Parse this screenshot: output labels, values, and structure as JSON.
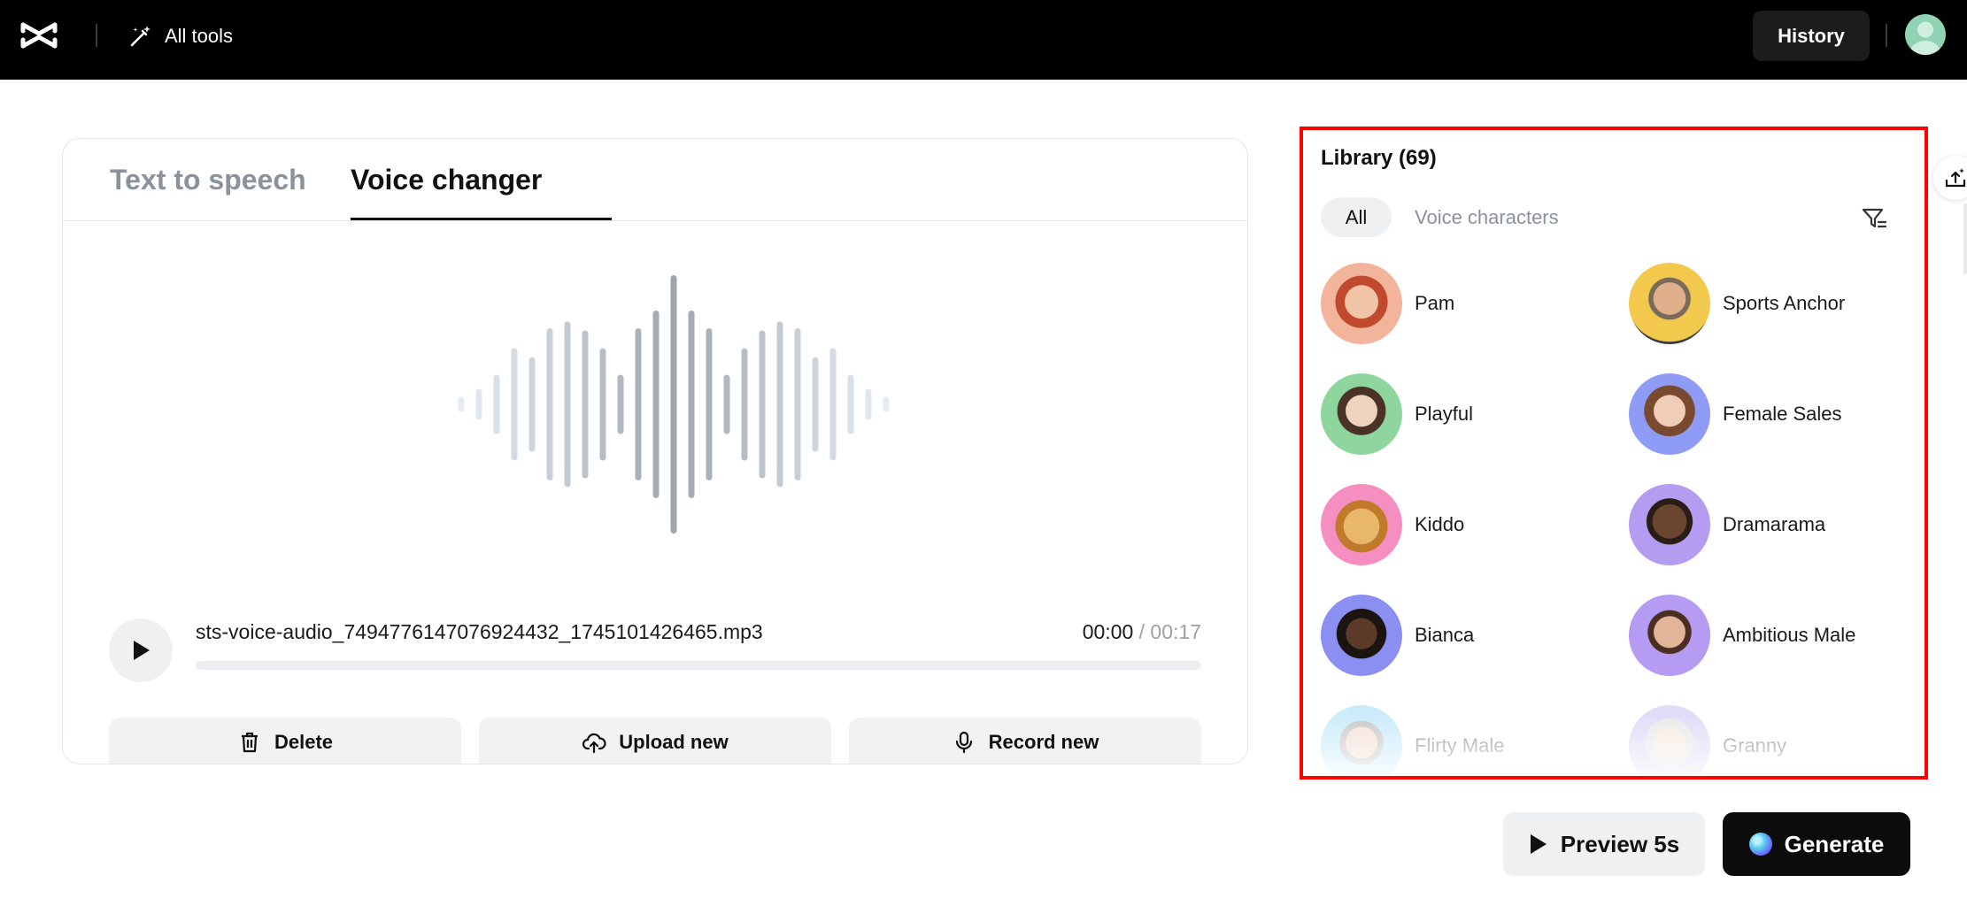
{
  "topbar": {
    "all_tools_label": "All tools",
    "history_label": "History"
  },
  "editor": {
    "tabs": [
      {
        "label": "Text to speech",
        "active": false
      },
      {
        "label": "Voice changer",
        "active": true
      }
    ],
    "audio": {
      "filename": "sts-voice-audio_7494776147076924432_1745101426465.mp3",
      "current_time": "00:00",
      "total_time": "/ 00:17",
      "progress": 0
    },
    "actions": {
      "delete_label": "Delete",
      "upload_label": "Upload new",
      "record_label": "Record new"
    }
  },
  "library": {
    "title": "Library (69)",
    "filters": {
      "all_label": "All",
      "voice_characters_label": "Voice characters"
    },
    "voices": [
      {
        "name": "Pam"
      },
      {
        "name": "Sports Anchor"
      },
      {
        "name": "Playful"
      },
      {
        "name": "Female Sales"
      },
      {
        "name": "Kiddo"
      },
      {
        "name": "Dramarama"
      },
      {
        "name": "Bianca"
      },
      {
        "name": "Ambitious Male"
      },
      {
        "name": "Flirty Male"
      },
      {
        "name": "Granny"
      }
    ]
  },
  "footer": {
    "preview_label": "Preview 5s",
    "generate_label": "Generate"
  },
  "colors": {
    "topbar": "#000000",
    "highlight_border": "#ff0000",
    "button_light": "#eef0f2",
    "generate_bg": "#0c0c0c"
  }
}
